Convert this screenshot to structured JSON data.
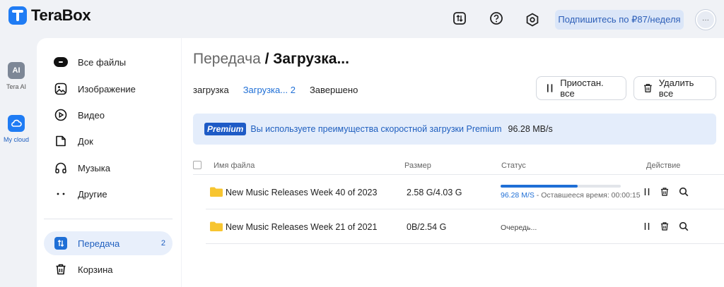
{
  "app": {
    "brand": "TeraBox"
  },
  "header": {
    "subscribe_label": "Подпишитесь по ₽87/неделя",
    "avatar_label": "···"
  },
  "rail": {
    "items": [
      {
        "label": "Tera AI",
        "icon": "ai-icon",
        "color": "#7d8796"
      },
      {
        "label": "My cloud",
        "icon": "cloud-icon",
        "color": "#1f7cf4"
      }
    ]
  },
  "sidebar": {
    "items": [
      {
        "label": "Все файлы",
        "icon": "all-files-icon"
      },
      {
        "label": "Изображение",
        "icon": "image-icon"
      },
      {
        "label": "Видео",
        "icon": "video-icon"
      },
      {
        "label": "Док",
        "icon": "document-icon"
      },
      {
        "label": "Музыка",
        "icon": "headphones-icon"
      },
      {
        "label": "Другие",
        "icon": "more-dots-icon"
      }
    ],
    "transfer": {
      "label": "Передача",
      "count": "2",
      "icon": "transfer-icon"
    },
    "trash": {
      "label": "Корзина",
      "icon": "trash-icon"
    }
  },
  "main": {
    "breadcrumb_parent": "Передача",
    "breadcrumb_separator": " / ",
    "breadcrumb_current": "Загрузка...",
    "tabs": [
      {
        "label": "загрузка",
        "active": false
      },
      {
        "label": "Загрузка... 2",
        "active": true
      },
      {
        "label": "Завершено",
        "active": false
      }
    ],
    "pause_all_label": "Приостан. все",
    "delete_all_label": "Удалить все",
    "banner": {
      "badge": "Premium",
      "text": "Вы используете преимущества скоростной загрузки Premium",
      "speed": "96.28 MB/s"
    },
    "table": {
      "columns": [
        "Имя файла",
        "Размер",
        "Статус",
        "Действие"
      ],
      "rows": [
        {
          "name": "New Music Releases Week 40 of 2023",
          "size": "2.58 G/4.03 G",
          "progress": 0.64,
          "speed": "96.28 M/S",
          "status_text": " - Оставшееся время: 00:00:15"
        },
        {
          "name": "New Music Releases Week 21 of 2021",
          "size": "0B/2.54 G",
          "status_text": "Очередь..."
        }
      ]
    }
  },
  "colors": {
    "accent": "#1f6fd6",
    "banner_bg": "#e4edfb",
    "folder": "#f7c530"
  }
}
